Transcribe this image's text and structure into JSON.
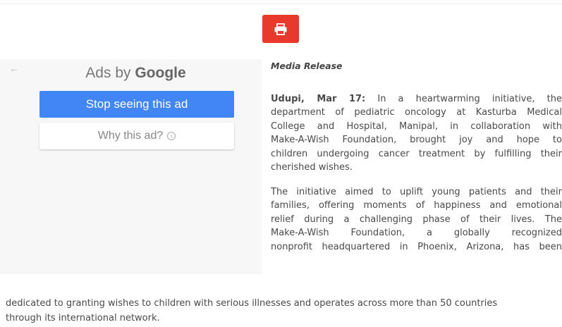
{
  "toolbar": {
    "print_icon": "printer-icon",
    "accent_color": "#e8392c"
  },
  "ad": {
    "back_icon": "←",
    "ads_by": "Ads by ",
    "brand": "Google",
    "stop_label": "Stop seeing this ad",
    "why_label": "Why this ad?",
    "info_icon": "i",
    "button_color": "#4285f4"
  },
  "article": {
    "label": "Media Release",
    "p1": {
      "dateline": "Udupi, Mar 17:",
      "line1": " In a heartwarming initiative, the",
      "line2": "department of pediatric oncology at Kasturba Medical",
      "line3": "College and Hospital, Manipal, in collaboration with",
      "line4": "Make-A-Wish Foundation, brought joy and hope to",
      "line5": "children undergoing cancer treatment by fulfilling their",
      "line6": "cherished wishes."
    },
    "p2": {
      "line1": "The initiative aimed to uplift young patients and their",
      "line2": "families, offering moments of happiness and emotional",
      "line3": "relief during a challenging phase of their lives. The",
      "line4": "Make-A-Wish Foundation, a globally recognized",
      "line5": "nonprofit headquartered in Phoenix, Arizona, has been",
      "line6": "dedicated to granting wishes to children with serious illnesses and operates across more than 50 countries",
      "line7": "through its international network."
    }
  }
}
